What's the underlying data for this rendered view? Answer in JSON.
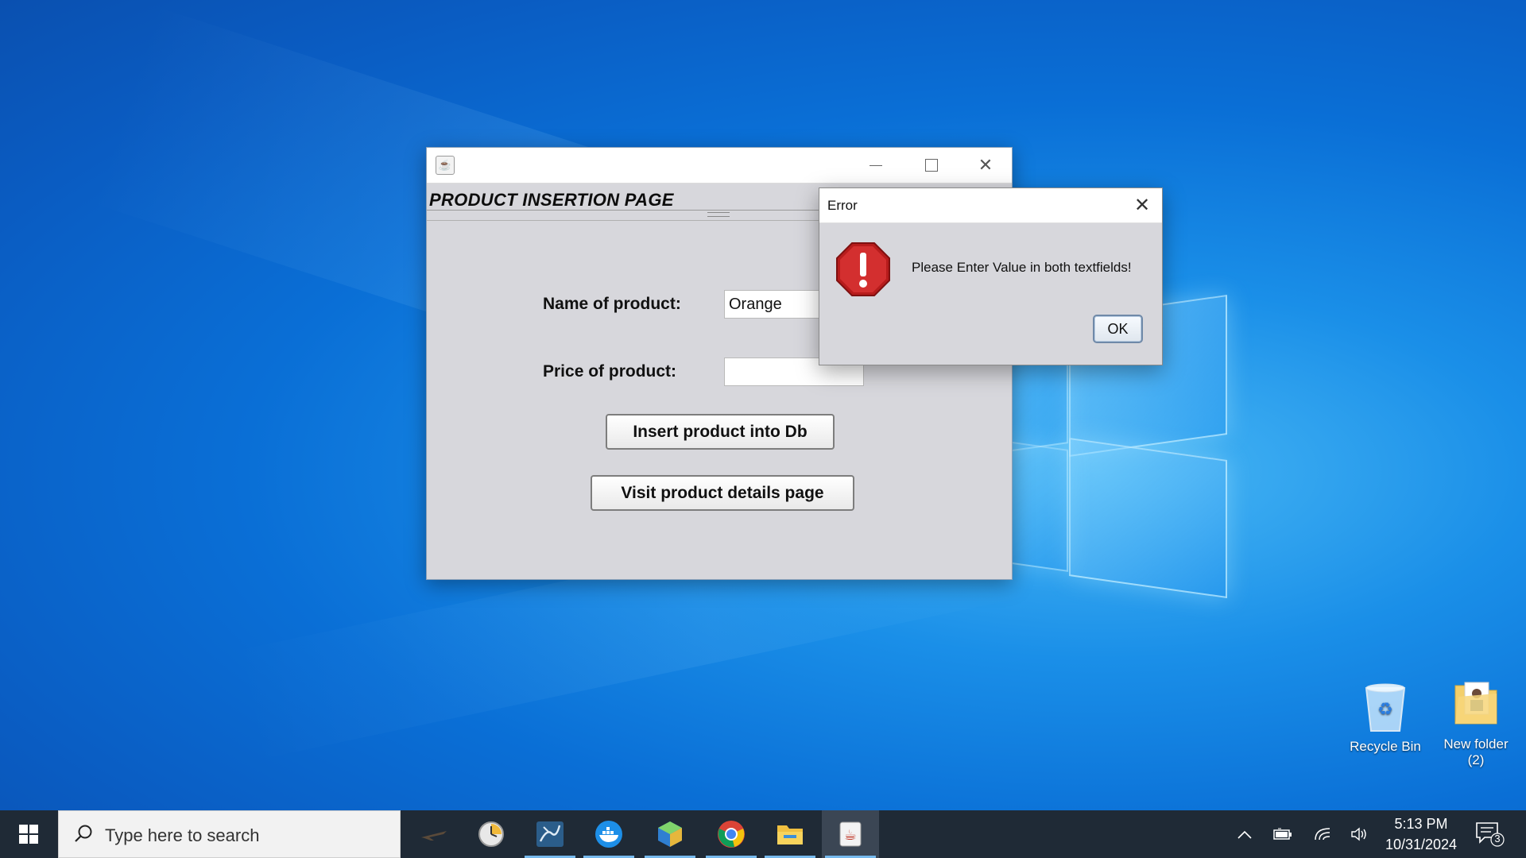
{
  "app": {
    "heading": "PRODUCT INSERTION PAGE",
    "name_label": "Name of product:",
    "name_value": "Orange",
    "price_label": "Price of product:",
    "price_value": "",
    "insert_button": "Insert product into Db",
    "visit_button": "Visit product details page"
  },
  "dialog": {
    "title": "Error",
    "message": "Please Enter Value in both textfields!",
    "ok_label": "OK"
  },
  "desktop": {
    "recycle_bin": "Recycle Bin",
    "new_folder_line1": "New folder",
    "new_folder_line2": "(2)"
  },
  "taskbar": {
    "search_placeholder": "Type here to search",
    "time": "5:13 PM",
    "date": "10/31/2024",
    "notification_count": "3"
  },
  "icons": {
    "start": "windows-start-icon",
    "search": "search-icon",
    "apps": [
      "flight-icon",
      "clock-icon",
      "mysql-workbench-icon",
      "docker-icon",
      "cube-ide-icon",
      "chrome-icon",
      "file-explorer-icon",
      "java-icon"
    ],
    "tray": [
      "chevron-up-icon",
      "battery-icon",
      "wifi-icon",
      "volume-icon",
      "notification-icon"
    ]
  },
  "colors": {
    "desktop_blue": "#0a6fd6",
    "taskbar": "#1f2a36",
    "error_red": "#c62828"
  }
}
